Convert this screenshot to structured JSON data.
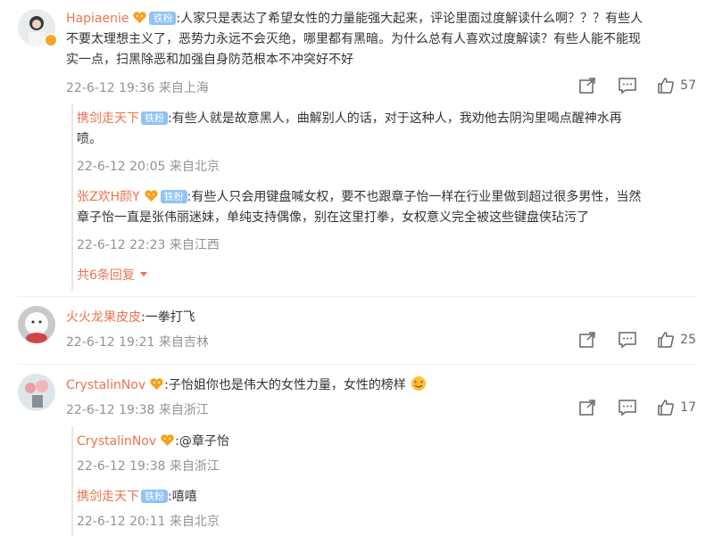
{
  "comments": [
    {
      "user": "Hapiaenie",
      "fan_badge": "铁粉",
      "text_line1": ":人家只是表达了希望女性的力量能强大起来，评论里面过度解读什么啊？？？有些人",
      "text_line2": "不要太理想主义了，恶势力永远不会灭绝，哪里都有黑暗。为什么总有人喜欢过度解读？有些人能不能现",
      "text_line3": "实一点，扫黑除恶和加强自身防范根本不冲突好不好",
      "time": "22-6-12 19:36 来自上海",
      "likes": "57",
      "replies": [
        {
          "user": "携剑走天下",
          "fan_badge": "铁粉",
          "text_line1": ":有些人就是故意黑人，曲解别人的话，对于这种人，我劝他去阴沟里喝点醒神水再",
          "text_line2": "喷。",
          "time": "22-6-12 20:05 来自北京"
        },
        {
          "user": "张Z欢H颜Y",
          "fan_badge": "铁粉",
          "text_line1": ":有些人只会用键盘喊女权，要不也跟章子怡一样在行业里做到超过很多男性，当然",
          "text_line2": "章子怡一直是张伟丽迷妹，单纯支持偶像，别在这里打拳，女权意义完全被这些键盘侠玷污了",
          "time": "22-6-12 22:23 来自江西"
        }
      ],
      "more_replies": "共6条回复"
    },
    {
      "user": "火火龙果皮皮",
      "text_line1": ":一拳打飞",
      "time": "22-6-12 19:21 来自吉林",
      "likes": "25"
    },
    {
      "user": "CrystalinNov",
      "text_line1": ":子怡姐你也是伟大的女性力量，女性的榜样",
      "time": "22-6-12 19:38 来自浙江",
      "likes": "17",
      "replies": [
        {
          "user": "CrystalinNov",
          "text_line1": ":@章子怡",
          "time": "22-6-12 19:38 来自浙江"
        },
        {
          "user": "携剑走天下",
          "fan_badge": "铁粉",
          "text_line1": ":嘻嘻",
          "time": "22-6-12 20:11 来自北京"
        }
      ]
    }
  ],
  "icons": {
    "share": "share-icon",
    "comment": "comment-icon",
    "like": "thumbs-up-icon",
    "verified": "verified-badge-icon",
    "heart_badge": "heart-fan-badge-icon",
    "chevron": "chevron-down-icon",
    "emoji": "heart-eyes-emoji-icon"
  },
  "colors": {
    "username": "#eb7350",
    "meta": "#939393",
    "fan_badge": "#8fc2f6"
  }
}
